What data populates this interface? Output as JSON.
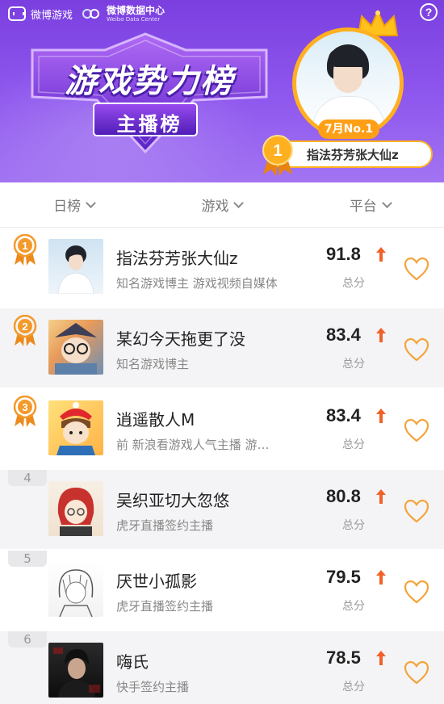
{
  "header": {
    "brand_weibo_game": "微博游戏",
    "brand_data_center": "微博数据中心",
    "brand_data_center_en": "Weibo Data Center",
    "help_label": "?",
    "title": "游戏势力榜",
    "subtitle": "主播榜",
    "champion": {
      "month_tag": "7月No.1",
      "rank": "1",
      "name": "指法芬芳张大仙z"
    }
  },
  "filters": [
    {
      "label": "日榜"
    },
    {
      "label": "游戏"
    },
    {
      "label": "平台"
    }
  ],
  "rows": [
    {
      "rank": "1",
      "name": "指法芬芳张大仙z",
      "desc": "知名游戏博主 游戏视频自媒体",
      "score": "91.8",
      "score_label": "总分"
    },
    {
      "rank": "2",
      "name": "某幻今天拖更了没",
      "desc": "知名游戏博主",
      "score": "83.4",
      "score_label": "总分"
    },
    {
      "rank": "3",
      "name": "逍遥散人M",
      "desc": "前 新浪看游戏人气主播 游…",
      "score": "83.4",
      "score_label": "总分"
    },
    {
      "rank": "4",
      "name": "吴织亚切大忽悠",
      "desc": "虎牙直播签约主播",
      "score": "80.8",
      "score_label": "总分"
    },
    {
      "rank": "5",
      "name": "厌世小孤影",
      "desc": "虎牙直播签约主播",
      "score": "79.5",
      "score_label": "总分"
    },
    {
      "rank": "6",
      "name": "嗨氏",
      "desc": "快手签约主播",
      "score": "78.5",
      "score_label": "总分"
    }
  ],
  "colors": {
    "header_purple": "#7b3fe0",
    "gold": "#ffb020",
    "medal_orange": "#f39a2b",
    "up_arrow": "#f0622a",
    "heart": "#f3a43a"
  },
  "icons": {
    "help": "question-circle-icon",
    "chevron": "chevron-down-icon",
    "medal": "medal-icon",
    "up": "up-arrow-icon",
    "like": "heart-icon",
    "crown": "crown-icon"
  }
}
